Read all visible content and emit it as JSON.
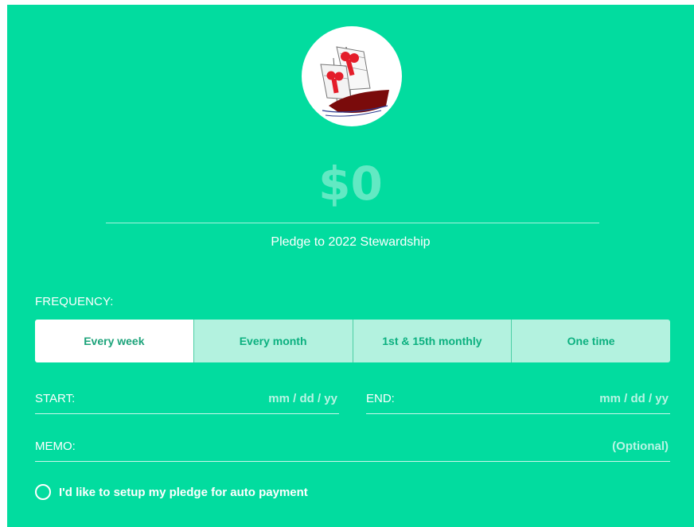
{
  "logo": {
    "icon": "ship-logo-icon"
  },
  "amount": {
    "value": "$0"
  },
  "pledge": {
    "title": "Pledge to 2022 Stewardship"
  },
  "frequency": {
    "label": "FREQUENCY:",
    "options": [
      "Every week",
      "Every month",
      "1st & 15th monthly",
      "One time"
    ],
    "selected": "Every week"
  },
  "start": {
    "label": "START:",
    "placeholder": "mm / dd / yy"
  },
  "end": {
    "label": "END:",
    "placeholder": "mm / dd / yy"
  },
  "memo": {
    "label": "MEMO:",
    "placeholder": "(Optional)"
  },
  "auto_payment": {
    "label": "I'd like to setup my pledge for auto payment",
    "checked": false
  },
  "colors": {
    "background": "#02dc9f",
    "button_inactive": "#b3f2df",
    "button_active": "#ffffff"
  }
}
